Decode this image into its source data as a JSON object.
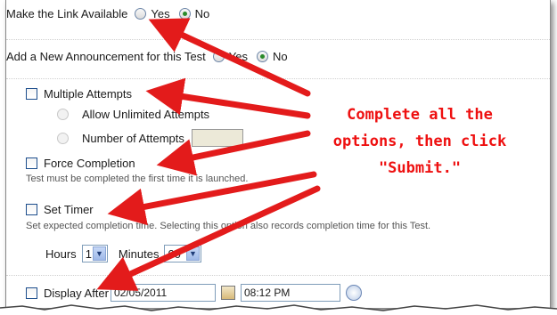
{
  "link_available": {
    "label": "Make the Link Available",
    "yes": "Yes",
    "no": "No",
    "selected": "No"
  },
  "announcement": {
    "label": "Add a New Announcement for this Test",
    "yes": "Yes",
    "no": "No",
    "selected": "No"
  },
  "multiple_attempts": {
    "label": "Multiple Attempts",
    "checked": false,
    "unlimited_label": "Allow Unlimited Attempts",
    "number_label": "Number of Attempts",
    "number_value": ""
  },
  "force_completion": {
    "label": "Force Completion",
    "help": "Test must be completed the first time it is launched.",
    "checked": false
  },
  "set_timer": {
    "label": "Set Timer",
    "help": "Set expected completion time. Selecting this option also records completion time for this Test.",
    "checked": false,
    "hours_label": "Hours",
    "hours_value": "1",
    "minutes_label": "Minutes",
    "minutes_value": "00"
  },
  "display_after": {
    "label": "Display After",
    "date": "02/05/2011",
    "time": "08:12 PM",
    "checked": false
  },
  "callout": {
    "line1": "Complete all the",
    "line2": "options, then click",
    "line3": "\"Submit.\"",
    "color": "#ee1010"
  },
  "arrow_color": "#e31b1b"
}
